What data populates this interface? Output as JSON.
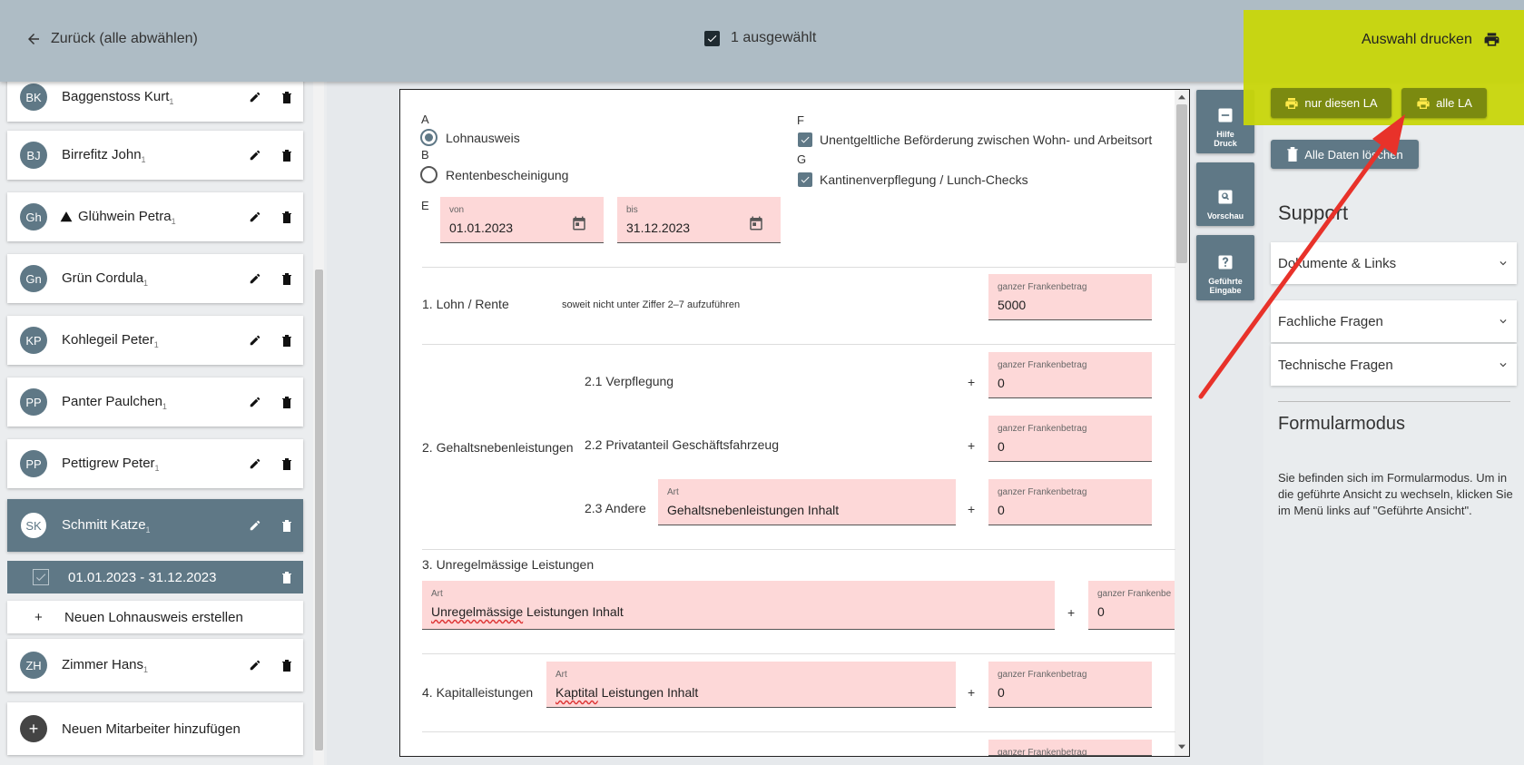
{
  "topbar": {
    "back_label": "Zurück (alle abwählen)",
    "selected_label": "1 ausgewählt",
    "print_selection_label": "Auswahl drucken",
    "only_this_la_label": "nur diesen LA",
    "all_la_label": "alle LA"
  },
  "employees": [
    {
      "initials": "BK",
      "name": "Baggenstoss Kurt",
      "count": "1"
    },
    {
      "initials": "BJ",
      "name": "Birrefitz John",
      "count": "1"
    },
    {
      "initials": "Gh",
      "name": "Glühwein Petra",
      "count": "1",
      "warning": true
    },
    {
      "initials": "Gn",
      "name": "Grün Cordula",
      "count": "1"
    },
    {
      "initials": "KP",
      "name": "Kohlegeil Peter",
      "count": "1"
    },
    {
      "initials": "PP",
      "name": "Panter Paulchen",
      "count": "1"
    },
    {
      "initials": "PP",
      "name": "Pettigrew Peter",
      "count": "1"
    },
    {
      "initials": "SK",
      "name": "Schmitt Katze",
      "count": "1",
      "selected": true
    },
    {
      "initials": "ZH",
      "name": "Zimmer Hans",
      "count": "1"
    }
  ],
  "selected_period": "01.01.2023 - 31.12.2023",
  "new_la_label": "Neuen Lohnausweis erstellen",
  "new_la_plus": "+",
  "add_employee_label": "Neuen Mitarbeiter hinzufügen",
  "add_employee_plus": "+",
  "form": {
    "a_letter": "A",
    "b_letter": "B",
    "e_letter": "E",
    "f_letter": "F",
    "g_letter": "G",
    "lohnausweis": "Lohnausweis",
    "rentenbescheinigung": "Rentenbescheinigung",
    "f_text": "Unentgeltliche Beförderung zwischen Wohn- und Arbeitsort",
    "g_text": "Kantinenverpflegung / Lunch-Checks",
    "von_caption": "von",
    "von_value": "01.01.2023",
    "bis_caption": "bis",
    "bis_value": "31.12.2023",
    "row1_label": "1. Lohn / Rente",
    "row1_note": "soweit nicht unter Ziffer 2–7 aufzuführen",
    "amount_caption": "ganzer Frankenbetrag",
    "row1_value": "5000",
    "row2_label": "2. Gehaltsnebenleistungen",
    "row21_label": "2.1 Verpflegung",
    "row21_value": "0",
    "row22_label": "2.2 Privatanteil Geschäftsfahrzeug",
    "row22_value": "0",
    "row23_label": "2.3 Andere",
    "art_caption": "Art",
    "row23_art": "Gehaltsnebenleistungen Inhalt",
    "row23_value": "0",
    "row3_label": "3. Unregelmässige Leistungen",
    "row3_art_first": "Unregelmässige",
    "row3_art_rest": " Leistungen Inhalt",
    "row3_caption": "ganzer Frankenbe",
    "row3_value": "0",
    "row4_label": "4. Kapitalleistungen",
    "row4_art_first": "Kaptital",
    "row4_art_rest": " Leistungen Inhalt",
    "row4_value": "0",
    "plus_sign": "+"
  },
  "tools": [
    {
      "label": "Hilfe Druck",
      "icon": "minus-box-icon"
    },
    {
      "label": "Vorschau",
      "icon": "preview-icon"
    },
    {
      "label": "Geführte Eingabe",
      "icon": "help-box-icon"
    }
  ],
  "tool_labels": {
    "t1a": "Hilfe",
    "t1b": "Druck",
    "t2": "Vorschau",
    "t3a": "Geführte",
    "t3b": "Eingabe"
  },
  "right": {
    "delete_all_label": "Alle Daten löschen",
    "support_title": "Support",
    "acc1": "Dokumente & Links",
    "acc2": "Fachliche Fragen",
    "acc3": "Technische Fragen",
    "mode_title": "Formularmodus",
    "mode_text": "Sie befinden sich im Formularmodus. Um in die geführte Ansicht zu wechseln, klicken Sie im Menü links auf \"Geführte Ansicht\"."
  },
  "colors": {
    "highlight": "#c8d60a",
    "accent": "#5f7886",
    "field": "#fdd8d8",
    "arrow": "#e8322a"
  }
}
